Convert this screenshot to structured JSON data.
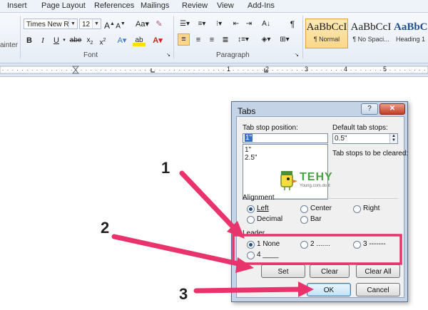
{
  "ribbon": {
    "tabs": [
      "Insert",
      "Page Layout",
      "References",
      "Mailings",
      "Review",
      "View",
      "Add-Ins"
    ],
    "painter_label": "ainter",
    "font_name": "Times New Rom",
    "font_size": "12",
    "font_group_label": "Font",
    "paragraph_group_label": "Paragraph",
    "styles": [
      {
        "sample": "AaBbCcI",
        "name": "¶ Normal"
      },
      {
        "sample": "AaBbCcI",
        "name": "¶ No Spaci..."
      },
      {
        "sample": "AaBbCc",
        "name": "Heading 1"
      }
    ]
  },
  "ruler": {
    "numbers": [
      "1",
      "2",
      "3",
      "4",
      "5"
    ]
  },
  "dialog": {
    "title": "Tabs",
    "help_glyph": "?",
    "close_glyph": "✕",
    "tab_stop_position_label": "Tab stop position:",
    "tab_stop_position_value": "1\"",
    "tab_stops": [
      "1\"",
      "2.5\""
    ],
    "default_tab_stops_label": "Default tab stops:",
    "default_tab_stops_value": "0.5\"",
    "to_be_cleared_label": "Tab stops to be cleared:",
    "alignment_label": "Alignment",
    "alignment_options": [
      "Left",
      "Center",
      "Right",
      "Decimal",
      "Bar"
    ],
    "alignment_selected": "Left",
    "leader_label": "Leader",
    "leader_options": [
      "1 None",
      "2 .......",
      "3 -------",
      "4 ____"
    ],
    "leader_selected": "1 None",
    "buttons": {
      "set": "Set",
      "clear": "Clear",
      "clear_all": "Clear All",
      "ok": "OK",
      "cancel": "Cancel"
    }
  },
  "watermark": {
    "brand": "TEHY",
    "tagline": "Young.com.do it"
  },
  "annotations": {
    "step1": "1",
    "step2": "2",
    "step3": "3",
    "color": "#e8336d"
  }
}
